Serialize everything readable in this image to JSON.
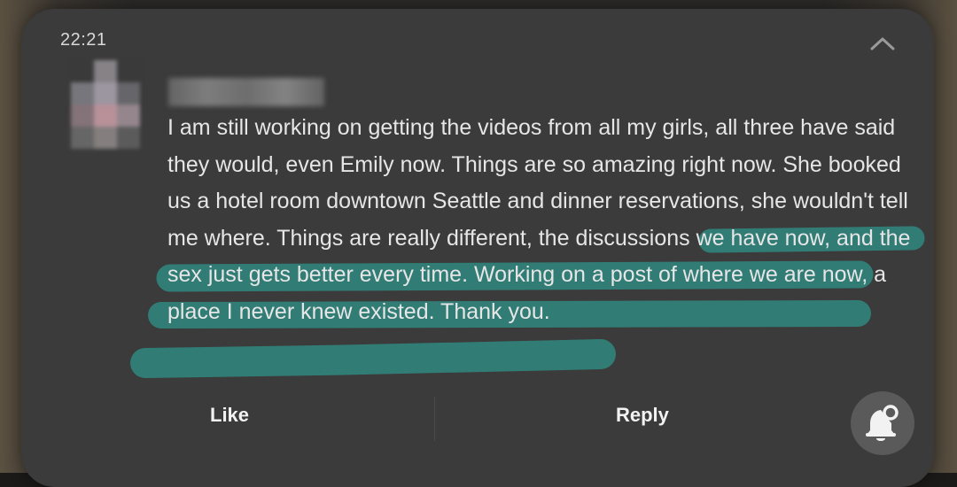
{
  "notification": {
    "time": "22:21",
    "message": {
      "before_highlight": "I am still working on getting the videos from all my girls, all three have said they would, even Emily now. Things are so amazing right now. She booked us a hotel room downtown Seattle and dinner reservations, she wouldn't tell me where. ",
      "highlighted": "Things are really different, the discussions we have now, and the sex just gets better every time. Working on a post of where we are now, a place I never knew existed. Thank you."
    },
    "actions": {
      "like_label": "Like",
      "reply_label": "Reply"
    },
    "icons": {
      "collapse": "chevron-up-icon",
      "notification": "bell-icon"
    },
    "colors": {
      "card_background": "#3b3b3b",
      "text": "#e6e6e6",
      "highlight": "#2f8b83"
    }
  }
}
